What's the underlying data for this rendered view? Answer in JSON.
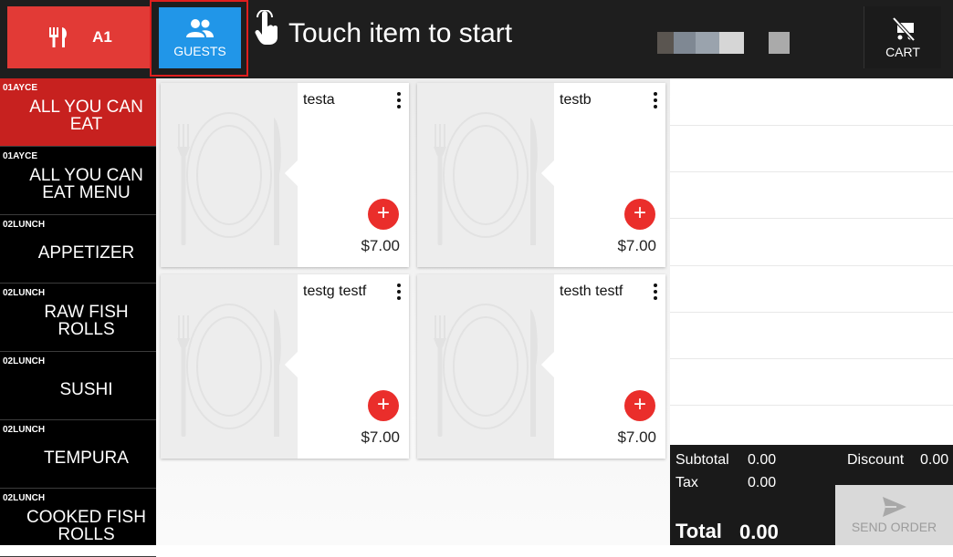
{
  "header": {
    "table_label": "A1",
    "guests_label": "GUESTS",
    "prompt": "Touch item to start",
    "cart_label": "CART",
    "colors": {
      "table": "#e23a36",
      "guests": "#2196e8",
      "bar": "#1e1e1e"
    }
  },
  "categories": [
    {
      "code": "01AYCE",
      "name": "ALL YOU CAN EAT",
      "active": true
    },
    {
      "code": "01AYCE",
      "name": "ALL YOU CAN EAT MENU",
      "active": false
    },
    {
      "code": "02LUNCH",
      "name": "APPETIZER",
      "active": false
    },
    {
      "code": "02LUNCH",
      "name": "RAW FISH ROLLS",
      "active": false
    },
    {
      "code": "02LUNCH",
      "name": "SUSHI",
      "active": false
    },
    {
      "code": "02LUNCH",
      "name": "TEMPURA",
      "active": false
    },
    {
      "code": "02LUNCH",
      "name": "COOKED FISH ROLLS",
      "active": false
    }
  ],
  "items": [
    {
      "name": "testa",
      "price": "$7.00"
    },
    {
      "name": "testb",
      "price": "$7.00"
    },
    {
      "name": "testg testf",
      "price": "$7.00"
    },
    {
      "name": "testh testf",
      "price": "$7.00"
    }
  ],
  "totals": {
    "subtotal_label": "Subtotal",
    "subtotal_value": "0.00",
    "discount_label": "Discount",
    "discount_value": "0.00",
    "tax_label": "Tax",
    "tax_value": "0.00",
    "total_label": "Total",
    "total_value": "0.00",
    "send_label": "SEND ORDER"
  }
}
